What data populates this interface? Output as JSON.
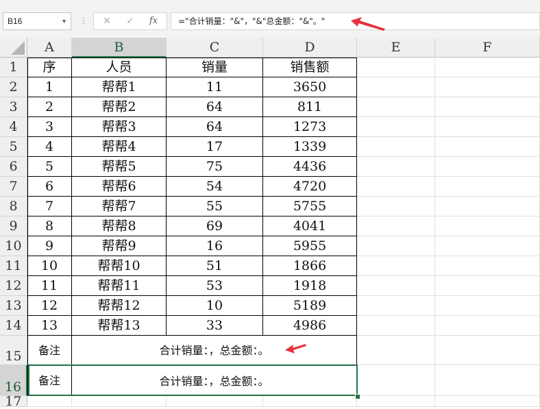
{
  "name_box": "B16",
  "formula": "=\"合计销量：\"&\"，\"&\"总金额：\"&\"。\"",
  "formula_buttons": {
    "cancel": "✕",
    "enter": "✓",
    "fx": "fx"
  },
  "columns": [
    "A",
    "B",
    "C",
    "D",
    "E",
    "F"
  ],
  "selected_column": "B",
  "rows": [
    "1",
    "2",
    "3",
    "4",
    "5",
    "6",
    "7",
    "8",
    "9",
    "10",
    "11",
    "12",
    "13",
    "14",
    "15",
    "16",
    "17"
  ],
  "selected_row": "16",
  "table": {
    "header": [
      "序",
      "人员",
      "销量",
      "销售额"
    ],
    "records": [
      [
        "1",
        "帮帮1",
        "11",
        "3650"
      ],
      [
        "2",
        "帮帮2",
        "64",
        "811"
      ],
      [
        "3",
        "帮帮3",
        "64",
        "1273"
      ],
      [
        "4",
        "帮帮4",
        "17",
        "1339"
      ],
      [
        "5",
        "帮帮5",
        "75",
        "4436"
      ],
      [
        "6",
        "帮帮6",
        "54",
        "4720"
      ],
      [
        "7",
        "帮帮7",
        "55",
        "5755"
      ],
      [
        "8",
        "帮帮8",
        "69",
        "4041"
      ],
      [
        "9",
        "帮帮9",
        "16",
        "5955"
      ],
      [
        "10",
        "帮帮10",
        "51",
        "1866"
      ],
      [
        "11",
        "帮帮11",
        "53",
        "1918"
      ],
      [
        "12",
        "帮帮12",
        "10",
        "5189"
      ],
      [
        "13",
        "帮帮13",
        "33",
        "4986"
      ]
    ],
    "notes": [
      {
        "label": "备注",
        "text": "合计销量：，总金额：。"
      },
      {
        "label": "备注",
        "text": "合计销量：，总金额：。"
      }
    ]
  },
  "colors": {
    "accent": "#217346",
    "arrow": "#e8313a"
  }
}
